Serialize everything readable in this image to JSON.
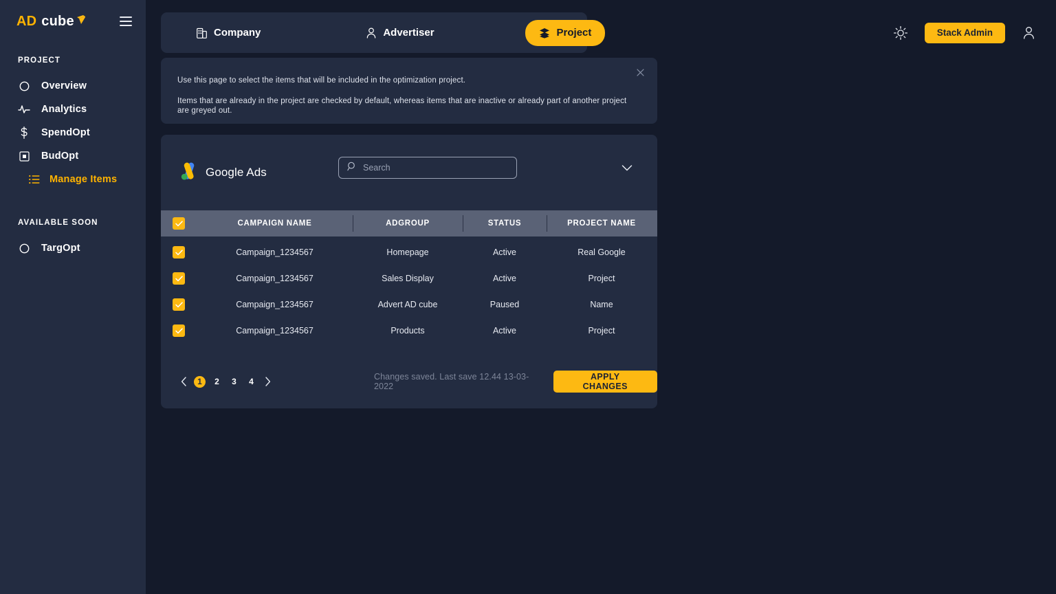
{
  "brand": {
    "logo_ad": "AD",
    "logo_cube": "cube",
    "accent": "#fdb912",
    "sidebar_bg": "#232c41",
    "page_bg": "#141a2a",
    "table_header_bg": "#5a6276"
  },
  "sidebar": {
    "section_project": "PROJECT",
    "section_soon": "AVAILABLE SOON",
    "items": [
      {
        "label": "Overview",
        "icon": "circle-icon"
      },
      {
        "label": "Analytics",
        "icon": "pulse-icon"
      },
      {
        "label": "SpendOpt",
        "icon": "dollar-icon"
      },
      {
        "label": "BudOpt",
        "icon": "square-in-square-icon"
      }
    ],
    "sub_item": {
      "label": "Manage Items",
      "icon": "list-icon"
    },
    "soon_items": [
      {
        "label": "TargOpt",
        "icon": "circle-icon"
      }
    ]
  },
  "topbar": {
    "tabs": [
      {
        "label": "Company",
        "icon": "building-icon",
        "active": false
      },
      {
        "label": "Advertiser",
        "icon": "person-icon",
        "active": false
      },
      {
        "label": "Project",
        "icon": "layers-icon",
        "active": true
      }
    ],
    "theme_toggle_icon": "sun-icon",
    "stack_admin_label": "Stack Admin",
    "account_icon": "person-icon"
  },
  "banner": {
    "line1": "Use this page to select the items that will be included in the optimization project.",
    "line2": "Items that are already in the project are checked by default, whereas items that are inactive or already part of another project are greyed out.",
    "close_icon": "close-icon"
  },
  "card": {
    "provider_name": "Google Ads",
    "provider_logo": "google-ads-icon",
    "search": {
      "placeholder": "Search",
      "value": "",
      "icon": "search-icon"
    },
    "expand_icon": "chevron-down-icon",
    "table": {
      "select_all_checked": true,
      "columns": [
        "CAMPAIGN NAME",
        "ADGROUP",
        "STATUS",
        "PROJECT NAME"
      ],
      "rows": [
        {
          "checked": true,
          "campaign": "Campaign_1234567",
          "adgroup": "Homepage",
          "status": "Active",
          "project": "Real Google"
        },
        {
          "checked": true,
          "campaign": "Campaign_1234567",
          "adgroup": "Sales Display",
          "status": "Active",
          "project": "Project"
        },
        {
          "checked": true,
          "campaign": "Campaign_1234567",
          "adgroup": "Advert AD cube",
          "status": "Paused",
          "project": "Name"
        },
        {
          "checked": true,
          "campaign": "Campaign_1234567",
          "adgroup": "Products",
          "status": "Active",
          "project": "Project"
        }
      ]
    },
    "pagination": {
      "prev_icon": "chevron-left-icon",
      "next_icon": "chevron-right-icon",
      "pages": [
        "1",
        "2",
        "3",
        "4"
      ],
      "current": "1"
    },
    "save_note": "Changes saved. Last save 12.44 13-03-2022",
    "apply_label": "APPLY CHANGES"
  }
}
